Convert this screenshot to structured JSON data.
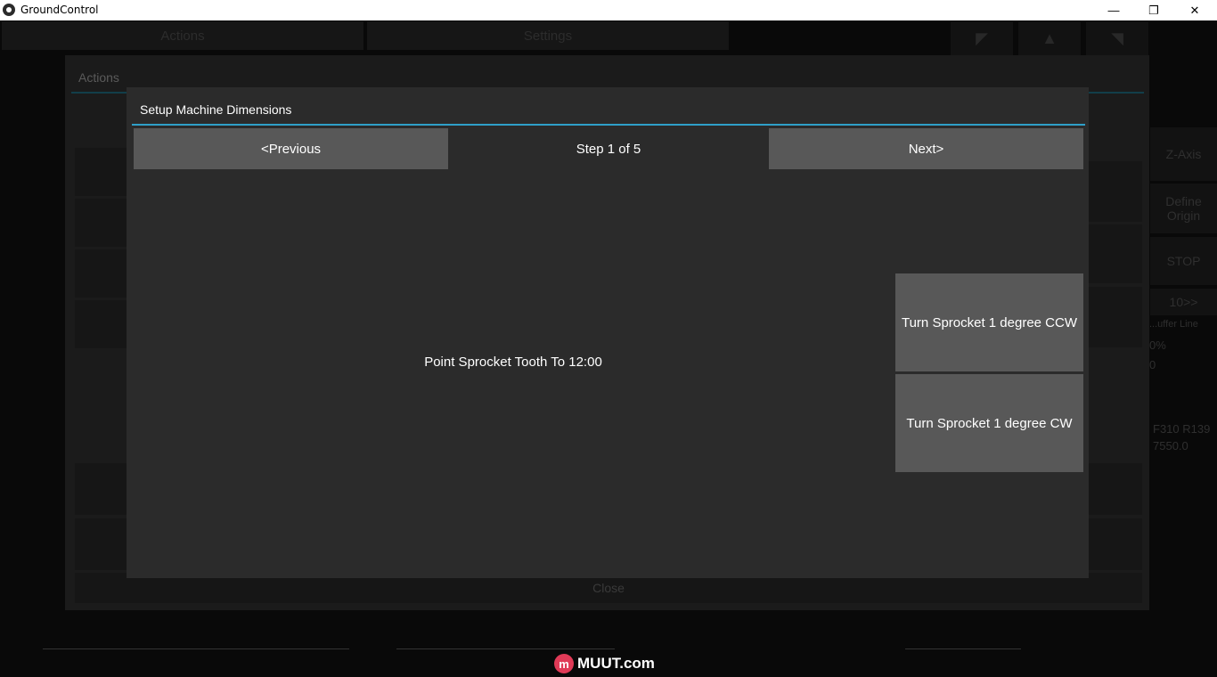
{
  "window": {
    "title": "GroundControl",
    "minimize_glyph": "—",
    "restore_glyph": "❐",
    "close_glyph": "✕"
  },
  "background": {
    "tabs": [
      "Actions",
      "Settings"
    ],
    "panel_title": "Actions",
    "close_label": "Close",
    "side_buttons": [
      "Z-Axis",
      "Define Origin",
      "STOP",
      "10>>"
    ],
    "side_texts": [
      "...uffer Line",
      "0%",
      "0",
      "F310 R139",
      "7550.0"
    ]
  },
  "dialog": {
    "title": "Setup Machine Dimensions",
    "previous_label": "<Previous",
    "step_label": "Step 1 of 5",
    "next_label": "Next>",
    "instruction": "Point Sprocket Tooth To 12:00",
    "ccw_label": "Turn Sprocket 1 degree CCW",
    "cw_label": "Turn Sprocket 1 degree CW"
  },
  "watermark": {
    "logo_letter": "m",
    "text": "MUUT.com"
  },
  "colors": {
    "dialog_bg": "#2b2b2b",
    "button_bg": "#585858",
    "accent": "#2f9fc8"
  }
}
